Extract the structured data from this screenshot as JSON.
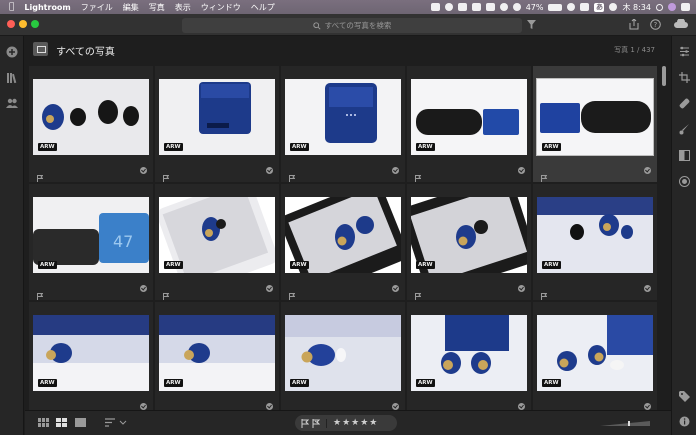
{
  "menubar": {
    "apple": "",
    "app_name": "Lightroom",
    "items": [
      "ファイル",
      "編集",
      "写真",
      "表示",
      "ウィンドウ",
      "ヘルプ"
    ],
    "battery": "47%",
    "ime": "あ",
    "clock": "木 8:34"
  },
  "search": {
    "placeholder": "すべての写真を検索"
  },
  "page": {
    "title": "すべての写真",
    "count": "写真 1 / 437"
  },
  "grid": {
    "badge": "ARW",
    "selected_index": 4,
    "photos": [
      {
        "name": "earbuds-on-white",
        "badge": "ARW"
      },
      {
        "name": "blue-case-front",
        "badge": "ARW"
      },
      {
        "name": "blue-case-closed",
        "badge": "ARW"
      },
      {
        "name": "black-and-blue-cases",
        "badge": "ARW"
      },
      {
        "name": "blue-case-with-black-case",
        "badge": "ARW"
      },
      {
        "name": "black-case-and-blue-case-logo",
        "badge": "ARW"
      },
      {
        "name": "earbud-on-phone-1",
        "badge": "ARW"
      },
      {
        "name": "earbud-on-phone-2",
        "badge": "ARW"
      },
      {
        "name": "earbud-on-phone-3",
        "badge": "ARW"
      },
      {
        "name": "earbuds-blue-box",
        "badge": "ARW"
      },
      {
        "name": "earbud-blue-bg-1",
        "badge": "ARW"
      },
      {
        "name": "earbud-blue-bg-2",
        "badge": "ARW"
      },
      {
        "name": "earbud-tip-1",
        "badge": "ARW"
      },
      {
        "name": "earbuds-gold-pair",
        "badge": "ARW"
      },
      {
        "name": "earbuds-tips-box",
        "badge": "ARW"
      }
    ]
  },
  "colors": {
    "accent": "#2a4a9a",
    "selected": "#3a3a3a",
    "bg": "#1e1e1e"
  },
  "bottom": {
    "rating": "★★★★★"
  }
}
